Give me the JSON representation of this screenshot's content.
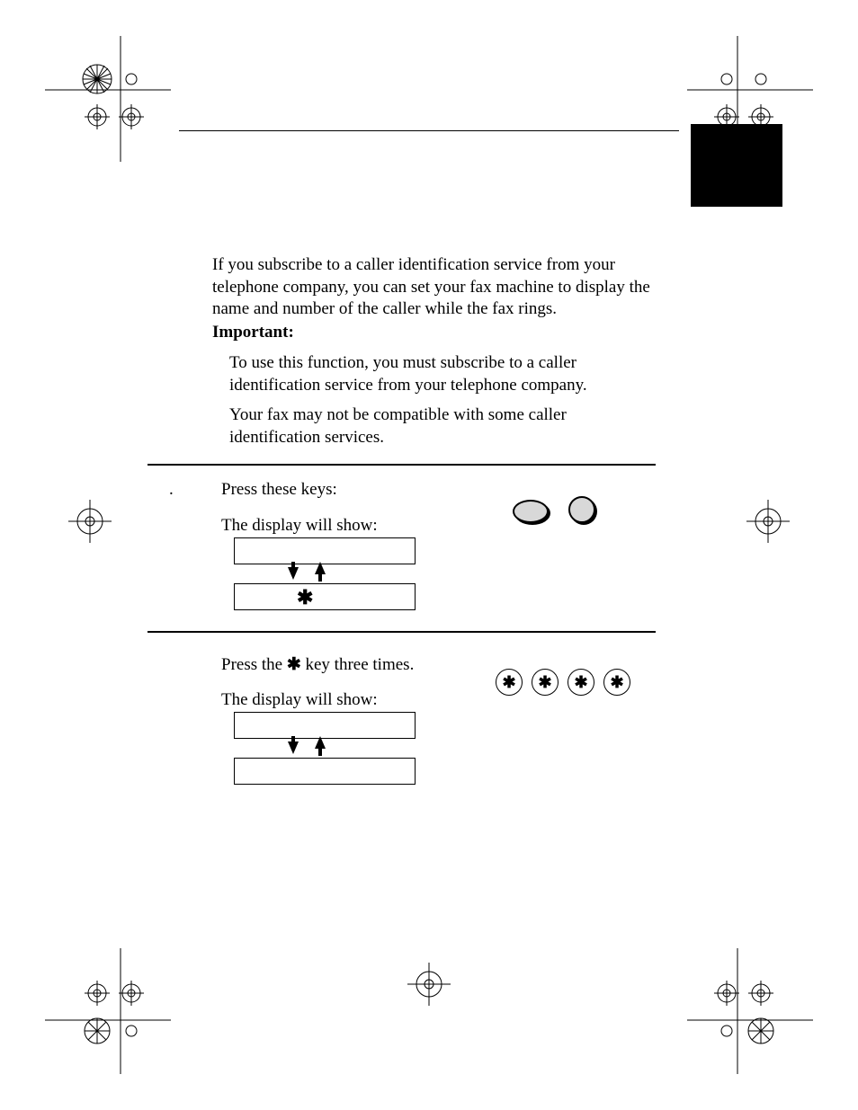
{
  "intro_paragraph": "If you subscribe to a caller identification service from your telephone company, you can set your fax machine to display the name and number of the caller while the fax rings.",
  "important_label": "Important:",
  "important_p1": "To use this function, you must subscribe to a caller identification service from your telephone company.",
  "important_p2": "Your fax may not be compatible with some caller identification services.",
  "step1": {
    "number": ".",
    "line1": "Press these keys:",
    "line2": "The display will show:",
    "star": "✱"
  },
  "step2": {
    "line1_pre": "Press the ",
    "line1_star": "✱",
    "line1_post": " key three times.",
    "line2": "The display will show:",
    "btn": "✱"
  }
}
